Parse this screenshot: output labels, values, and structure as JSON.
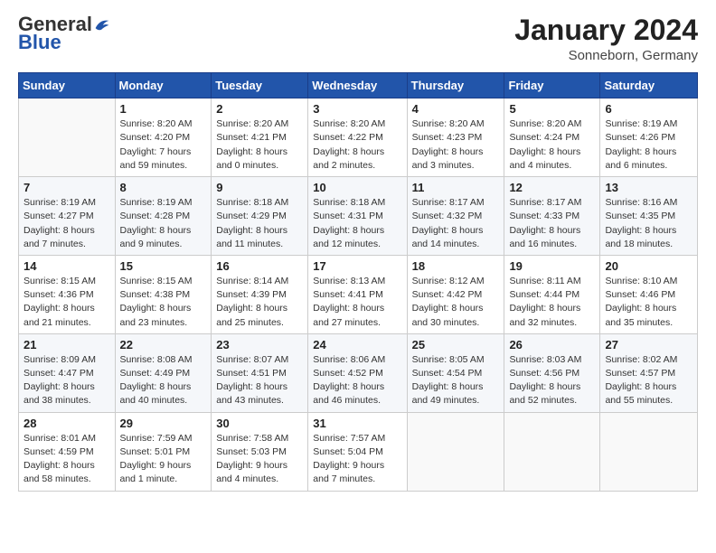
{
  "logo": {
    "general": "General",
    "blue": "Blue"
  },
  "header": {
    "month": "January 2024",
    "location": "Sonneborn, Germany"
  },
  "weekdays": [
    "Sunday",
    "Monday",
    "Tuesday",
    "Wednesday",
    "Thursday",
    "Friday",
    "Saturday"
  ],
  "weeks": [
    [
      {
        "day": "",
        "info": ""
      },
      {
        "day": "1",
        "info": "Sunrise: 8:20 AM\nSunset: 4:20 PM\nDaylight: 7 hours\nand 59 minutes."
      },
      {
        "day": "2",
        "info": "Sunrise: 8:20 AM\nSunset: 4:21 PM\nDaylight: 8 hours\nand 0 minutes."
      },
      {
        "day": "3",
        "info": "Sunrise: 8:20 AM\nSunset: 4:22 PM\nDaylight: 8 hours\nand 2 minutes."
      },
      {
        "day": "4",
        "info": "Sunrise: 8:20 AM\nSunset: 4:23 PM\nDaylight: 8 hours\nand 3 minutes."
      },
      {
        "day": "5",
        "info": "Sunrise: 8:20 AM\nSunset: 4:24 PM\nDaylight: 8 hours\nand 4 minutes."
      },
      {
        "day": "6",
        "info": "Sunrise: 8:19 AM\nSunset: 4:26 PM\nDaylight: 8 hours\nand 6 minutes."
      }
    ],
    [
      {
        "day": "7",
        "info": "Sunrise: 8:19 AM\nSunset: 4:27 PM\nDaylight: 8 hours\nand 7 minutes."
      },
      {
        "day": "8",
        "info": "Sunrise: 8:19 AM\nSunset: 4:28 PM\nDaylight: 8 hours\nand 9 minutes."
      },
      {
        "day": "9",
        "info": "Sunrise: 8:18 AM\nSunset: 4:29 PM\nDaylight: 8 hours\nand 11 minutes."
      },
      {
        "day": "10",
        "info": "Sunrise: 8:18 AM\nSunset: 4:31 PM\nDaylight: 8 hours\nand 12 minutes."
      },
      {
        "day": "11",
        "info": "Sunrise: 8:17 AM\nSunset: 4:32 PM\nDaylight: 8 hours\nand 14 minutes."
      },
      {
        "day": "12",
        "info": "Sunrise: 8:17 AM\nSunset: 4:33 PM\nDaylight: 8 hours\nand 16 minutes."
      },
      {
        "day": "13",
        "info": "Sunrise: 8:16 AM\nSunset: 4:35 PM\nDaylight: 8 hours\nand 18 minutes."
      }
    ],
    [
      {
        "day": "14",
        "info": "Sunrise: 8:15 AM\nSunset: 4:36 PM\nDaylight: 8 hours\nand 21 minutes."
      },
      {
        "day": "15",
        "info": "Sunrise: 8:15 AM\nSunset: 4:38 PM\nDaylight: 8 hours\nand 23 minutes."
      },
      {
        "day": "16",
        "info": "Sunrise: 8:14 AM\nSunset: 4:39 PM\nDaylight: 8 hours\nand 25 minutes."
      },
      {
        "day": "17",
        "info": "Sunrise: 8:13 AM\nSunset: 4:41 PM\nDaylight: 8 hours\nand 27 minutes."
      },
      {
        "day": "18",
        "info": "Sunrise: 8:12 AM\nSunset: 4:42 PM\nDaylight: 8 hours\nand 30 minutes."
      },
      {
        "day": "19",
        "info": "Sunrise: 8:11 AM\nSunset: 4:44 PM\nDaylight: 8 hours\nand 32 minutes."
      },
      {
        "day": "20",
        "info": "Sunrise: 8:10 AM\nSunset: 4:46 PM\nDaylight: 8 hours\nand 35 minutes."
      }
    ],
    [
      {
        "day": "21",
        "info": "Sunrise: 8:09 AM\nSunset: 4:47 PM\nDaylight: 8 hours\nand 38 minutes."
      },
      {
        "day": "22",
        "info": "Sunrise: 8:08 AM\nSunset: 4:49 PM\nDaylight: 8 hours\nand 40 minutes."
      },
      {
        "day": "23",
        "info": "Sunrise: 8:07 AM\nSunset: 4:51 PM\nDaylight: 8 hours\nand 43 minutes."
      },
      {
        "day": "24",
        "info": "Sunrise: 8:06 AM\nSunset: 4:52 PM\nDaylight: 8 hours\nand 46 minutes."
      },
      {
        "day": "25",
        "info": "Sunrise: 8:05 AM\nSunset: 4:54 PM\nDaylight: 8 hours\nand 49 minutes."
      },
      {
        "day": "26",
        "info": "Sunrise: 8:03 AM\nSunset: 4:56 PM\nDaylight: 8 hours\nand 52 minutes."
      },
      {
        "day": "27",
        "info": "Sunrise: 8:02 AM\nSunset: 4:57 PM\nDaylight: 8 hours\nand 55 minutes."
      }
    ],
    [
      {
        "day": "28",
        "info": "Sunrise: 8:01 AM\nSunset: 4:59 PM\nDaylight: 8 hours\nand 58 minutes."
      },
      {
        "day": "29",
        "info": "Sunrise: 7:59 AM\nSunset: 5:01 PM\nDaylight: 9 hours\nand 1 minute."
      },
      {
        "day": "30",
        "info": "Sunrise: 7:58 AM\nSunset: 5:03 PM\nDaylight: 9 hours\nand 4 minutes."
      },
      {
        "day": "31",
        "info": "Sunrise: 7:57 AM\nSunset: 5:04 PM\nDaylight: 9 hours\nand 7 minutes."
      },
      {
        "day": "",
        "info": ""
      },
      {
        "day": "",
        "info": ""
      },
      {
        "day": "",
        "info": ""
      }
    ]
  ]
}
